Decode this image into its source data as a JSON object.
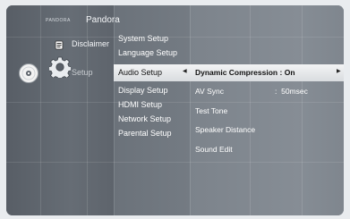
{
  "left_panel": {
    "brand_small": "PANDORA",
    "pandora": "Pandora",
    "disclaimer": "Disclaimer",
    "setup": "Setup"
  },
  "main_menu": {
    "items": [
      "System Setup",
      "Language Setup",
      "Audio Setup",
      "Display Setup",
      "HDMI Setup",
      "Network Setup",
      "Parental Setup"
    ],
    "selected_index": 2
  },
  "submenu": {
    "dynamic_compression_label": "Dynamic Compression",
    "dynamic_compression_value": "On",
    "av_sync_label": "AV Sync",
    "av_sync_value": "50msec",
    "test_tone": "Test Tone",
    "speaker_distance": "Speaker Distance",
    "sound_edit": "Sound Edit"
  },
  "icons": [
    "disc-icon",
    "gear-icon",
    "document-icon",
    "chevron-left-icon",
    "chevron-right-icon"
  ],
  "colors": {
    "highlight": "#e6e8ea",
    "panel": "#5f666e",
    "text": "#ffffff"
  }
}
